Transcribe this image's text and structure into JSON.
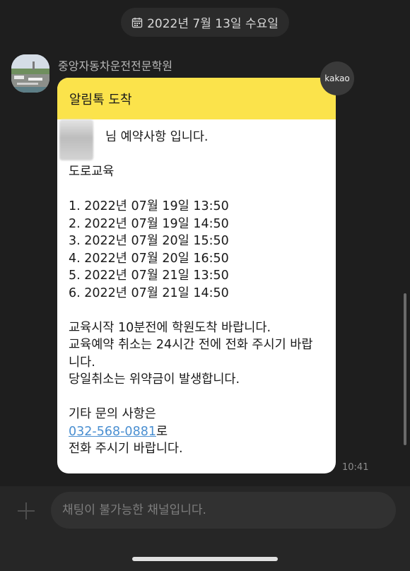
{
  "header": {
    "date_label": "2022년 7월 13일 수요일",
    "date_icon": "calendar-icon"
  },
  "message": {
    "sender_name": "중앙자동차운전전문학원",
    "badge_label": "kakao",
    "title": "알림톡 도착",
    "greeting": "님 예약사항 입니다.",
    "section_title": "도로교육",
    "schedule": [
      "1. 2022년 07월 19일 13:50",
      "2. 2022년 07월 19일 14:50",
      "3. 2022년 07월 20일 15:50",
      "4. 2022년 07월 20일 16:50",
      "5. 2022년 07월 21일 13:50",
      "6. 2022년 07월 21일 14:50"
    ],
    "notice_1": "교육시작 10분전에 학원도착 바랍니다.",
    "notice_2a": "교육예약 취소는 24시간 전에 전화 주시기 바랍",
    "notice_2b": "니다.",
    "notice_3": "당일취소는 위약금이 발생합니다.",
    "inquiry": "기타 문의 사항은",
    "phone": "032-568-0881",
    "phone_suffix": "로",
    "closing": "전화 주시기 바랍니다.",
    "time": "10:41"
  },
  "input": {
    "placeholder": "채팅이 불가능한 채널입니다.",
    "add_icon": "plus-icon"
  }
}
